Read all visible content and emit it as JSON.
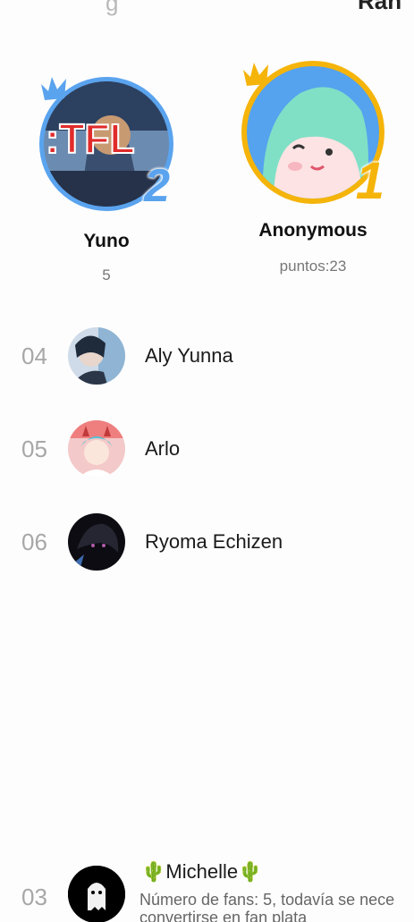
{
  "header": {
    "cut_left_text": "g",
    "cut_right_text": "Ran"
  },
  "podium": {
    "second": {
      "rank": "2",
      "name": "Yuno",
      "score": "5",
      "avatar_overlay_text": ":TFL"
    },
    "first": {
      "rank": "1",
      "name": "Anonymous",
      "score": "puntos:23"
    }
  },
  "ranking": [
    {
      "rank": "04",
      "name": "Aly Yunna"
    },
    {
      "rank": "05",
      "name": "Arlo"
    },
    {
      "rank": "06",
      "name": "Ryoma Echizen"
    }
  ],
  "current_user": {
    "rank": "03",
    "name": "🌵Michelle🌵",
    "desc_line1": "Número de fans: 5, todavía se nece",
    "desc_line2": "convertirse en fan plata"
  },
  "colors": {
    "silver_ring": "#5aa3ee",
    "gold_ring": "#f5b40a"
  }
}
